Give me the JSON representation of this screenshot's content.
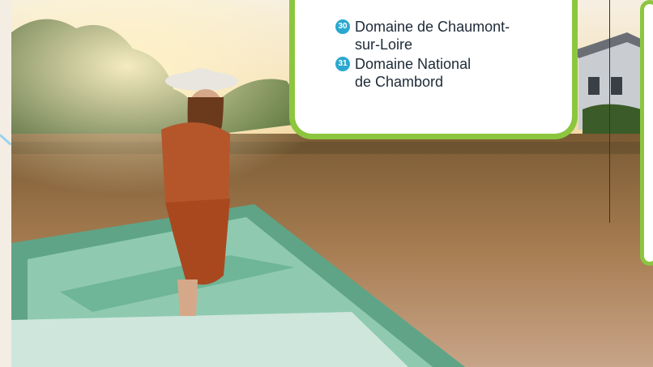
{
  "card": {
    "items": [
      {
        "number": "30",
        "line1": "Domaine de Chaumont-",
        "line2": "sur-Loire"
      },
      {
        "number": "31",
        "line1": "Domaine National",
        "line2": "de Chambord"
      }
    ]
  },
  "photo": {
    "icon": "woman-in-rowboat-photo"
  },
  "colors": {
    "accent_green": "#8cc63f",
    "badge_blue": "#2aa8cf",
    "boat_green": "#5fa487"
  }
}
